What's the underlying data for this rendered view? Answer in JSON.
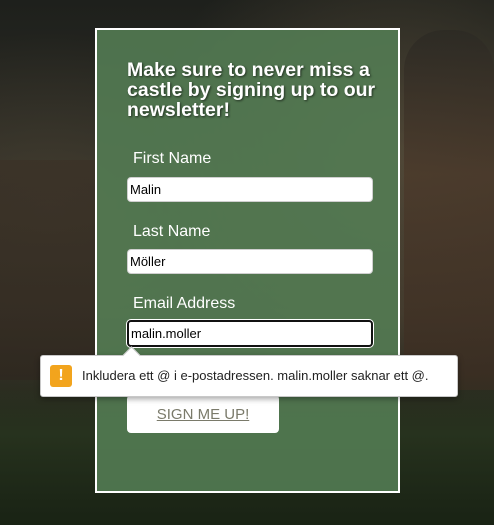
{
  "heading": "Make sure to never miss a castle by signing up to our newsletter!",
  "fields": {
    "first_name": {
      "label": "First Name",
      "value": "Malin"
    },
    "last_name": {
      "label": "Last Name",
      "value": "Möller"
    },
    "email": {
      "label": "Email Address",
      "value": "malin.moller"
    }
  },
  "signup_button": "SIGN ME UP!",
  "validation_tooltip": {
    "icon": "warning-icon",
    "icon_glyph": "!",
    "message": "Inkludera ett @ i e-postadressen. malin.moller saknar ett @."
  },
  "colors": {
    "panel": "#547d54",
    "warning": "#f2a41d"
  }
}
